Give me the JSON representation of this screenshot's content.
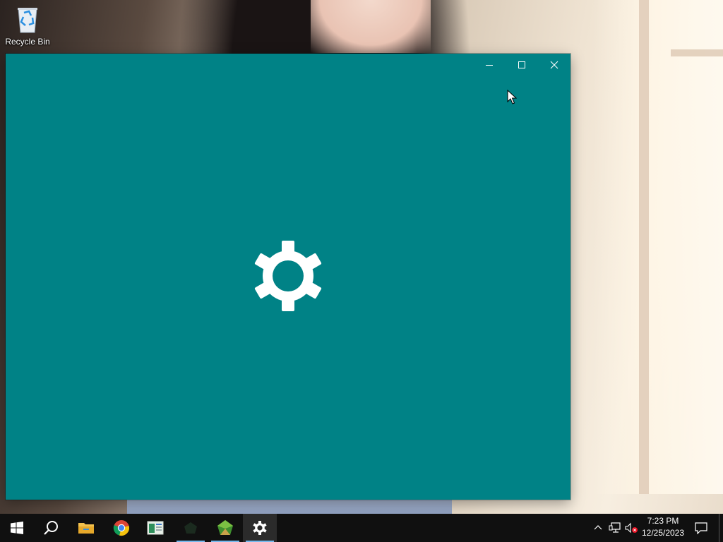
{
  "desktop": {
    "icons": [
      {
        "label": "Recycle Bin",
        "icon": "recycle-bin-icon"
      }
    ]
  },
  "window": {
    "app": "Settings",
    "state": "splash-loading",
    "background_color": "#008286",
    "splash_icon": "gear-icon",
    "controls": {
      "minimize": "minimize-icon",
      "maximize": "maximize-icon",
      "close": "close-icon"
    }
  },
  "taskbar": {
    "items": [
      {
        "name": "start",
        "icon": "windows-logo-icon"
      },
      {
        "name": "search",
        "icon": "search-icon"
      },
      {
        "name": "file-explorer",
        "icon": "folder-icon"
      },
      {
        "name": "chrome",
        "icon": "chrome-icon"
      },
      {
        "name": "app",
        "icon": "app-window-icon"
      },
      {
        "name": "app-dark",
        "icon": "dark-app-icon",
        "running": true
      },
      {
        "name": "app-green",
        "icon": "green-gem-icon",
        "running": true
      },
      {
        "name": "settings",
        "icon": "gear-icon",
        "running": true,
        "active": true
      }
    ],
    "tray": {
      "icons": [
        "chevron-up-icon",
        "network-icon",
        "volume-muted-icon"
      ],
      "time": "7:23 PM",
      "date": "12/25/2023"
    }
  }
}
